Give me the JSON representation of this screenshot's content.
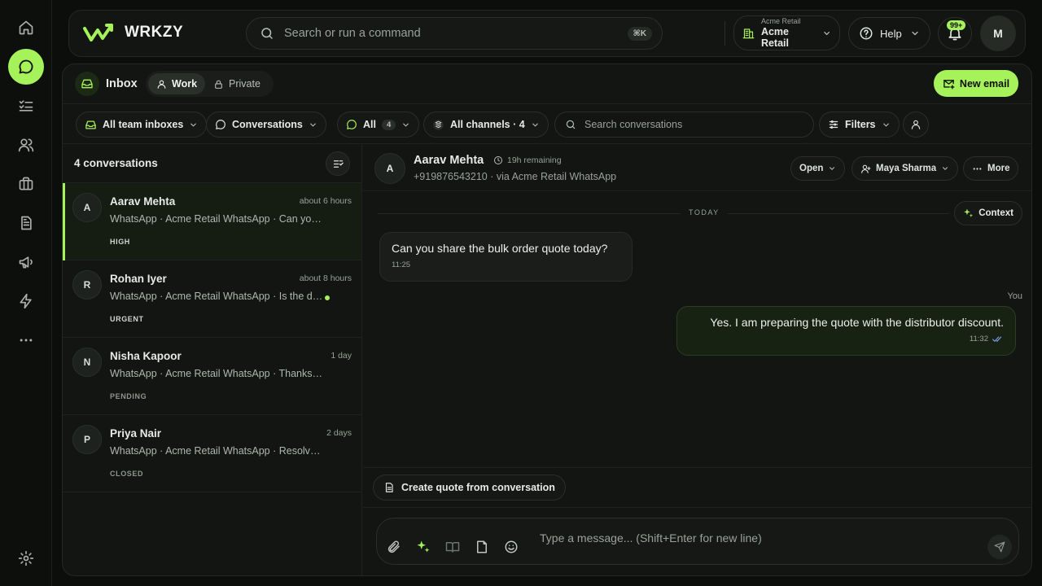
{
  "brand": {
    "name": "WRKZY"
  },
  "search": {
    "placeholder": "Search or run a command",
    "shortcut": "⌘K"
  },
  "org": {
    "label_small": "Acme Retail",
    "label": "Acme Retail"
  },
  "help": {
    "label": "Help"
  },
  "notifications": {
    "badge": "99+"
  },
  "user": {
    "initial": "M"
  },
  "inbox": {
    "title": "Inbox",
    "tabs": [
      {
        "label": "Work",
        "active": true
      },
      {
        "label": "Private",
        "active": false
      }
    ],
    "new_email_label": "New email"
  },
  "filters": {
    "team_inboxes": "All team inboxes",
    "conversations": "Conversations",
    "status": "All",
    "status_count": "4",
    "channels": "All channels · 4",
    "search_placeholder": "Search conversations",
    "filters_label": "Filters"
  },
  "list": {
    "title": "4 conversations",
    "items": [
      {
        "initial": "A",
        "name": "Aarav Mehta",
        "time": "about 6 hours",
        "preview": "WhatsApp · Acme Retail WhatsApp · Can you share the bulk order quote today?",
        "tag": "HIGH",
        "unread": false,
        "selected": true
      },
      {
        "initial": "R",
        "name": "Rohan Iyer",
        "time": "about 8 hours",
        "preview": "WhatsApp · Acme Retail WhatsApp · Is the delivery scheduled?",
        "tag": "URGENT",
        "unread": true,
        "selected": false
      },
      {
        "initial": "N",
        "name": "Nisha Kapoor",
        "time": "1 day",
        "preview": "WhatsApp · Acme Retail WhatsApp · Thanks for the update",
        "tag": "PENDING",
        "unread": false,
        "selected": false
      },
      {
        "initial": "P",
        "name": "Priya Nair",
        "time": "2 days",
        "preview": "WhatsApp · Acme Retail WhatsApp · Resolved, thank you",
        "tag": "CLOSED",
        "unread": false,
        "selected": false
      }
    ]
  },
  "chat": {
    "initial": "A",
    "name": "Aarav Mehta",
    "remaining": "19h remaining",
    "subtitle": "+919876543210 · via Acme Retail WhatsApp",
    "status_label": "Open",
    "assignee": "Maya Sharma",
    "more_label": "More",
    "day_label": "TODAY",
    "context_label": "Context",
    "you_label": "You",
    "messages": [
      {
        "direction": "in",
        "text": "Can you share the bulk order quote today?",
        "time": "11:25"
      },
      {
        "direction": "out",
        "text": "Yes. I am preparing the quote with the distributor discount.",
        "time": "11:32"
      }
    ],
    "quote_action": "Create quote from conversation",
    "composer_placeholder": "Type a message... (Shift+Enter for new line)"
  },
  "colors": {
    "accent": "#a6f25a",
    "background": "#0c0e0c",
    "panel": "#121512"
  }
}
